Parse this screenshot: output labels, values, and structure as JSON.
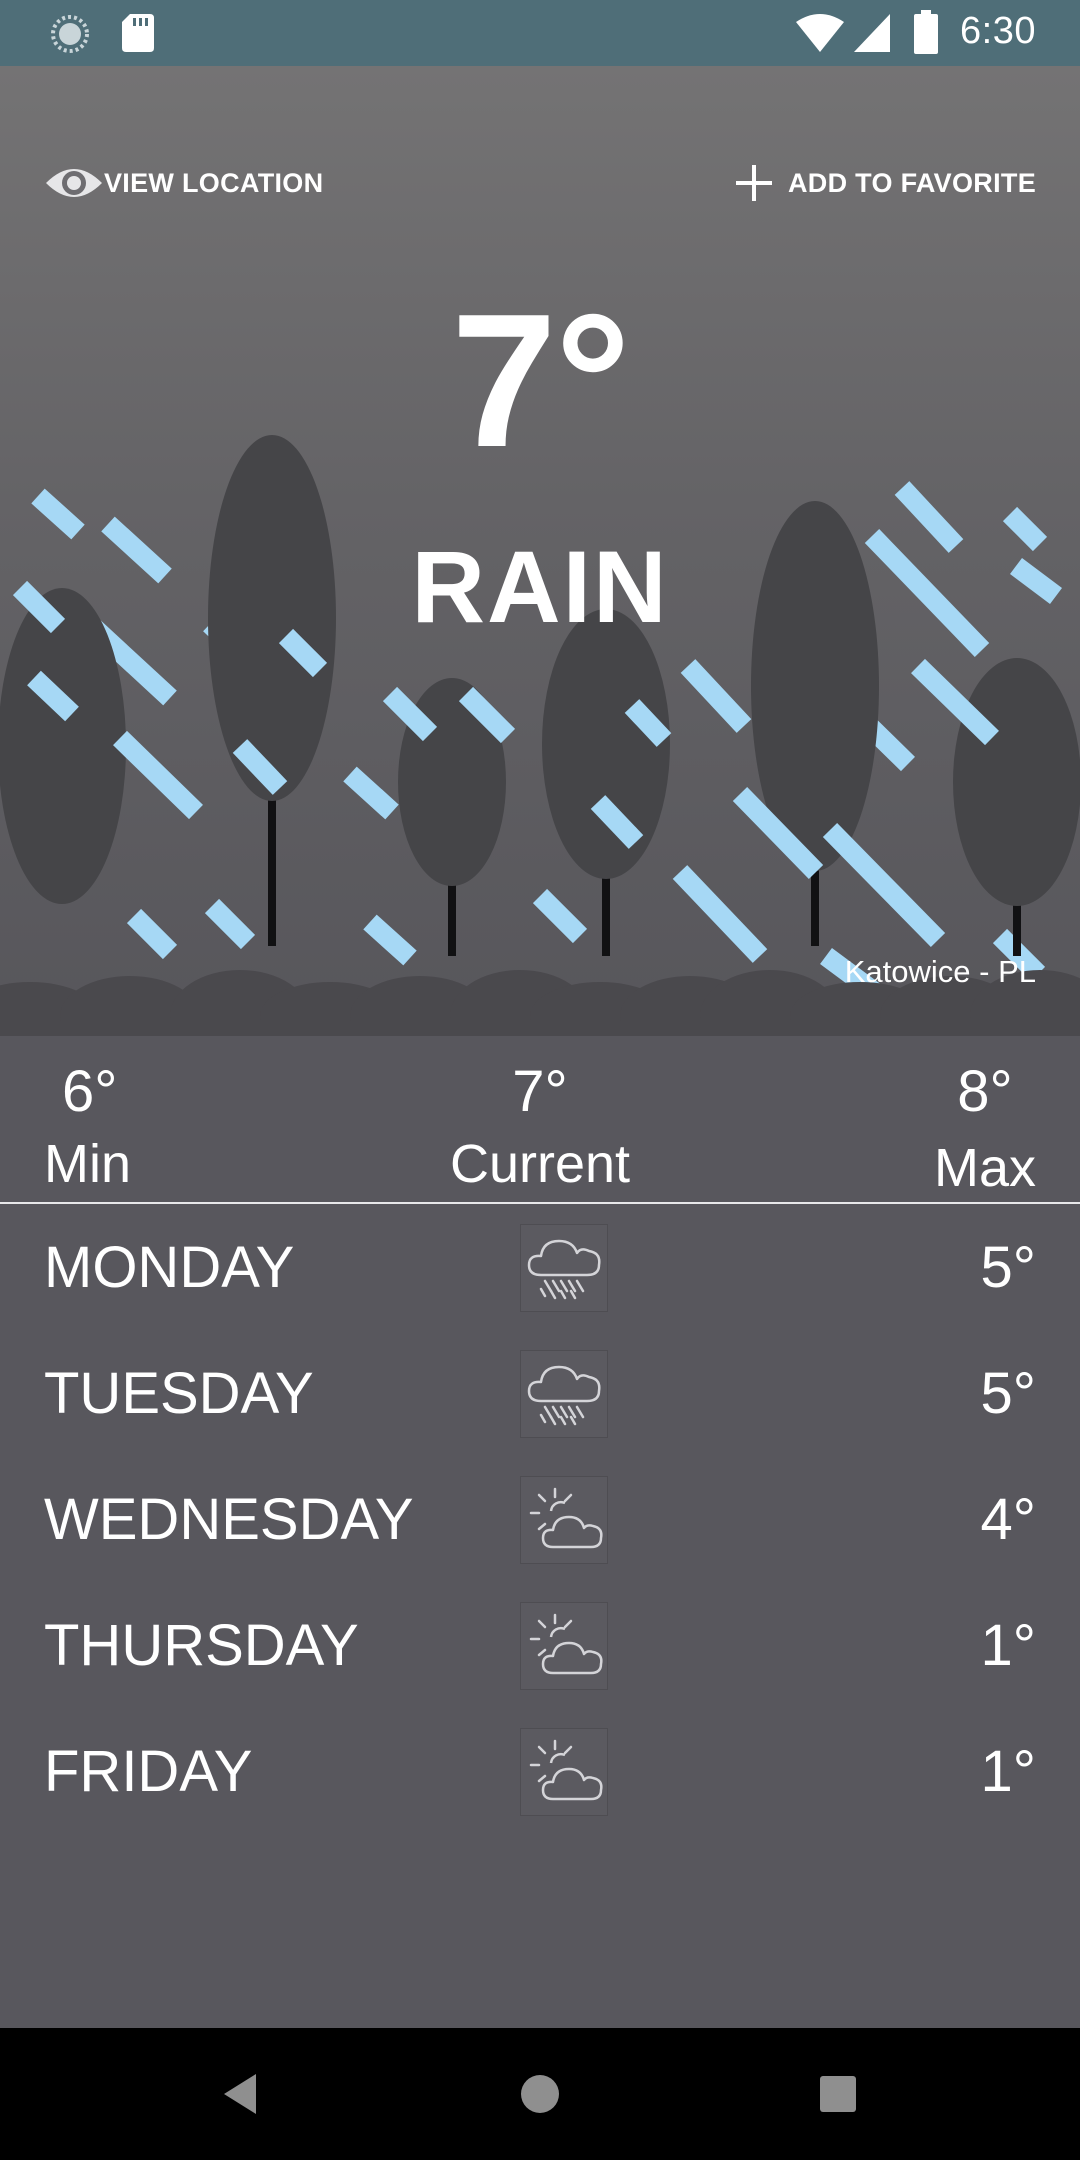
{
  "status_bar": {
    "time": "6:30",
    "icons": [
      "spinner-icon",
      "sd-card-icon",
      "wifi-icon",
      "cellular-icon",
      "battery-icon"
    ],
    "color": "#4f6e78"
  },
  "actions": {
    "view_location": "VIEW LOCATION",
    "add_favorite": "ADD TO FAVORITE"
  },
  "current": {
    "temperature": "7°",
    "condition": "RAIN",
    "location": "Katowice - PL"
  },
  "summary": {
    "min_value": "6°",
    "min_label": "Min",
    "current_value": "7°",
    "current_label": "Current",
    "max_value": "8°",
    "max_label": "Max"
  },
  "forecast": [
    {
      "day": "MONDAY",
      "icon": "rain-cloud-icon",
      "temp": "5°"
    },
    {
      "day": "TUESDAY",
      "icon": "rain-cloud-icon",
      "temp": "5°"
    },
    {
      "day": "WEDNESDAY",
      "icon": "partly-cloudy-icon",
      "temp": "4°"
    },
    {
      "day": "THURSDAY",
      "icon": "partly-cloudy-icon",
      "temp": "1°"
    },
    {
      "day": "FRIDAY",
      "icon": "partly-cloudy-icon",
      "temp": "1°"
    }
  ],
  "colors": {
    "rain": "#a6d8f5",
    "tree": "#454548",
    "background": "#58575d"
  },
  "nav_bar": {
    "buttons": [
      "back-icon",
      "home-icon",
      "recents-icon"
    ]
  }
}
